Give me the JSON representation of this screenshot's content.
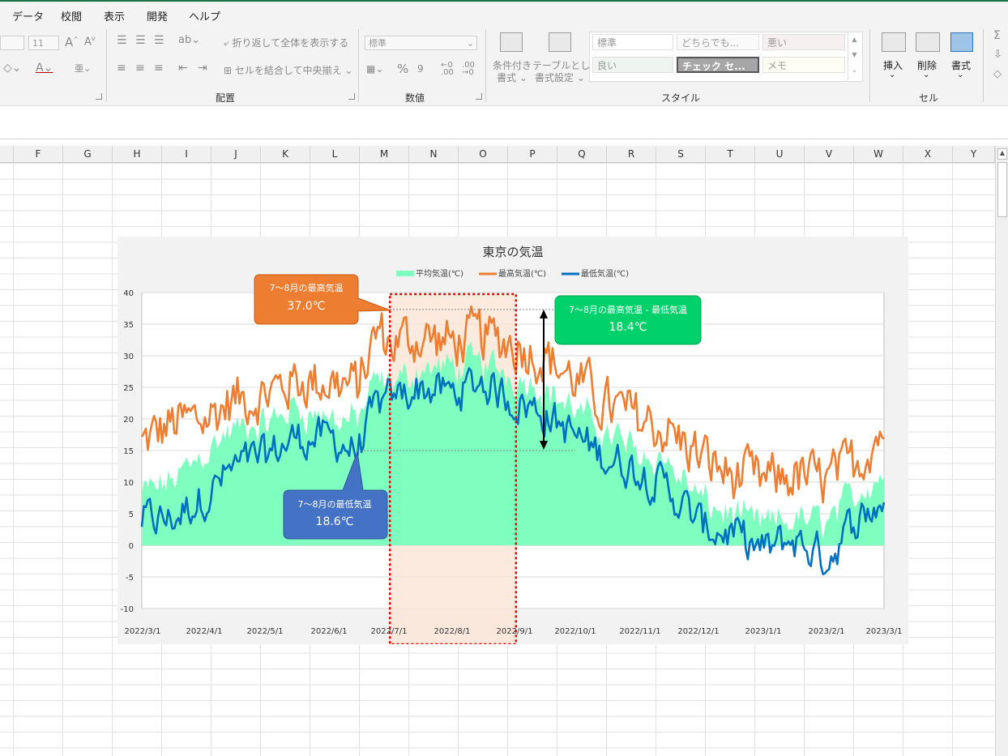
{
  "menu": [
    "データ",
    "校閲",
    "表示",
    "開発",
    "ヘルプ"
  ],
  "ribbon": {
    "font_size": "11",
    "wrap_text": "折り返して全体を表示する",
    "merge_center": "セルを結合して中央揃え",
    "number_format": "標準",
    "cond_format": [
      "条件付き",
      "書式"
    ],
    "table_format": [
      "テーブルとして",
      "書式設定"
    ],
    "styles": [
      "標準",
      "どちらでも...",
      "悪い",
      "良い",
      "チェック セ...",
      "メモ"
    ],
    "insert": "挿入",
    "delete": "削除",
    "format": "書式",
    "groups": {
      "alignment": "配置",
      "number": "数値",
      "style": "スタイル",
      "cells": "セル"
    }
  },
  "columns": [
    "F",
    "G",
    "H",
    "I",
    "J",
    "K",
    "L",
    "M",
    "N",
    "O",
    "P",
    "Q",
    "R",
    "S",
    "T",
    "U",
    "V",
    "W",
    "X",
    "Y"
  ],
  "chart_data": {
    "type": "area+line",
    "title": "東京の気温",
    "legend": [
      "平均気温(℃)",
      "最高気温(℃)",
      "最低気温(℃)"
    ],
    "legend_position": "top",
    "colors": {
      "avg": "#7fffbf",
      "max": "#ed7d31",
      "min": "#0070c0"
    },
    "ylim": [
      -10,
      40
    ],
    "y_ticks": [
      "40",
      "35",
      "30",
      "25",
      "20",
      "15",
      "10",
      "5",
      "0",
      "-5",
      "-10"
    ],
    "x_ticks": [
      "2022/3/1",
      "2022/4/1",
      "2022/5/1",
      "2022/6/1",
      "2022/7/1",
      "2022/8/1",
      "2022/9/1",
      "2022/10/1",
      "2022/11/1",
      "2022/12/1",
      "2023/1/1",
      "2023/2/1",
      "2023/3/1"
    ],
    "highlight_range": [
      "2022/7/1",
      "2022/8/31"
    ],
    "series_knots": {
      "dates": [
        "2022/3/1",
        "2022/3/15",
        "2022/4/1",
        "2022/4/15",
        "2022/5/1",
        "2022/5/15",
        "2022/6/1",
        "2022/6/15",
        "2022/6/25",
        "2022/7/1",
        "2022/7/15",
        "2022/8/1",
        "2022/8/15",
        "2022/8/31",
        "2022/9/15",
        "2022/10/1",
        "2022/10/15",
        "2022/11/1",
        "2022/11/15",
        "2022/12/1",
        "2022/12/15",
        "2023/1/1",
        "2023/1/15",
        "2023/2/1",
        "2023/2/15",
        "2023/3/1"
      ],
      "max": [
        16,
        19,
        20,
        23,
        24,
        26,
        26,
        25,
        34,
        32,
        33,
        32,
        33,
        32,
        30,
        26,
        22,
        20,
        18,
        14,
        11,
        10,
        11,
        10,
        13,
        19
      ],
      "avg": [
        8,
        10,
        15,
        18,
        19,
        22,
        20,
        20,
        26,
        25,
        28,
        28,
        29,
        27,
        25,
        21,
        18,
        15,
        13,
        7,
        5,
        3,
        4,
        4,
        8,
        12
      ],
      "min": [
        4,
        4,
        8,
        12,
        14,
        17,
        17,
        15,
        22,
        23,
        25,
        24,
        26,
        23,
        21,
        17,
        14,
        12,
        9,
        3,
        2,
        -1,
        1,
        -2,
        4,
        7
      ]
    },
    "annotations": {
      "max_title": "7〜8月の最高気温",
      "max_value": "37.0℃",
      "min_title": "7〜8月の最低気温",
      "min_value": "18.6℃",
      "diff_title": "7〜8月の最高気温 - 最低気温",
      "diff_value": "18.4℃"
    }
  }
}
